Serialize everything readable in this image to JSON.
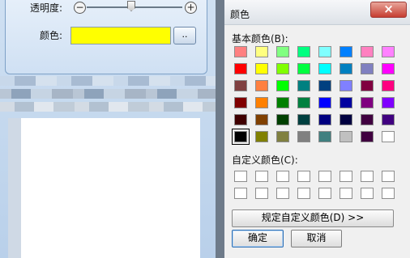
{
  "background_app": {
    "opacity_label": "透明度:",
    "color_label": "颜色:",
    "minus_icon": "minus-circle-icon",
    "plus_icon": "plus-circle-icon",
    "browse_label": "..",
    "selected_color": "#ffff00"
  },
  "dialog": {
    "title": "颜色",
    "close_label": "×",
    "basic_colors_label": "基本颜色(B):",
    "custom_colors_label": "自定义颜色(C):",
    "define_custom_label": "规定自定义颜色(D) >>",
    "ok_label": "确定",
    "cancel_label": "取消",
    "basic_colors": [
      "#ff8080",
      "#ffff80",
      "#80ff80",
      "#00ff80",
      "#80ffff",
      "#0080ff",
      "#ff80c0",
      "#ff80ff",
      "#ff0000",
      "#ffff00",
      "#80ff00",
      "#00ff40",
      "#00ffff",
      "#0080c0",
      "#8080c0",
      "#ff00ff",
      "#804040",
      "#ff8040",
      "#00ff00",
      "#008080",
      "#004080",
      "#8080ff",
      "#800040",
      "#ff0080",
      "#800000",
      "#ff8000",
      "#008000",
      "#008040",
      "#0000ff",
      "#0000a0",
      "#800080",
      "#8000ff",
      "#400000",
      "#804000",
      "#004000",
      "#004040",
      "#000080",
      "#000040",
      "#400040",
      "#400080",
      "#000000",
      "#808000",
      "#808040",
      "#808080",
      "#408080",
      "#c0c0c0",
      "#400040",
      "#ffffff"
    ],
    "selected_basic_index": 40,
    "custom_colors": [
      "#ffffff",
      "#ffffff",
      "#ffffff",
      "#ffffff",
      "#ffffff",
      "#ffffff",
      "#ffffff",
      "#ffffff",
      "#ffffff",
      "#ffffff",
      "#ffffff",
      "#ffffff",
      "#ffffff",
      "#ffffff",
      "#ffffff",
      "#ffffff"
    ]
  }
}
